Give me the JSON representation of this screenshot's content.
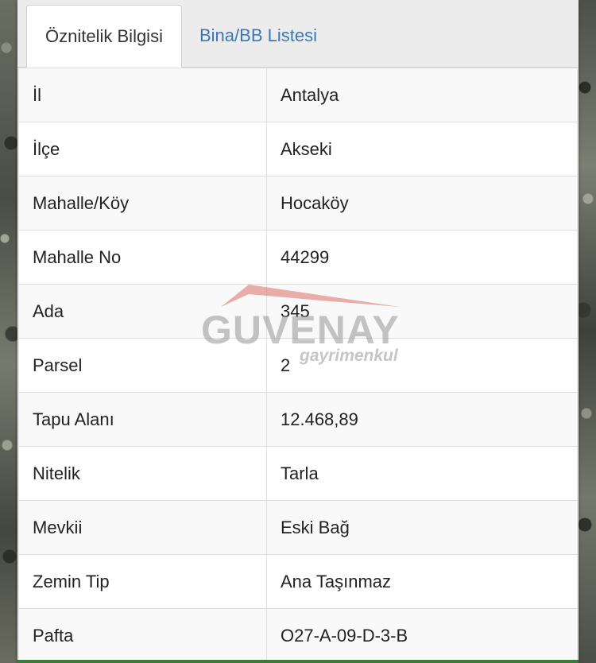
{
  "tabs": [
    {
      "label": "Öznitelik Bilgisi",
      "active": true
    },
    {
      "label": "Bina/BB Listesi",
      "active": false
    }
  ],
  "rows": [
    {
      "label": "İl",
      "value": "Antalya"
    },
    {
      "label": "İlçe",
      "value": "Akseki"
    },
    {
      "label": "Mahalle/Köy",
      "value": "Hocaköy"
    },
    {
      "label": "Mahalle No",
      "value": "44299"
    },
    {
      "label": "Ada",
      "value": "345"
    },
    {
      "label": "Parsel",
      "value": "2"
    },
    {
      "label": "Tapu Alanı",
      "value": "12.468,89"
    },
    {
      "label": "Nitelik",
      "value": "Tarla"
    },
    {
      "label": "Mevkii",
      "value": "Eski Bağ"
    },
    {
      "label": "Zemin Tip",
      "value": "Ana Taşınmaz"
    },
    {
      "label": "Pafta",
      "value": "O27-A-09-D-3-B"
    }
  ],
  "watermark": {
    "brand": "GUVENAY",
    "sub": "gayrimenkul"
  },
  "colors": {
    "link": "#3a77b8",
    "panel_bg": "#ececec",
    "row_alt": "#f9f9f9"
  }
}
